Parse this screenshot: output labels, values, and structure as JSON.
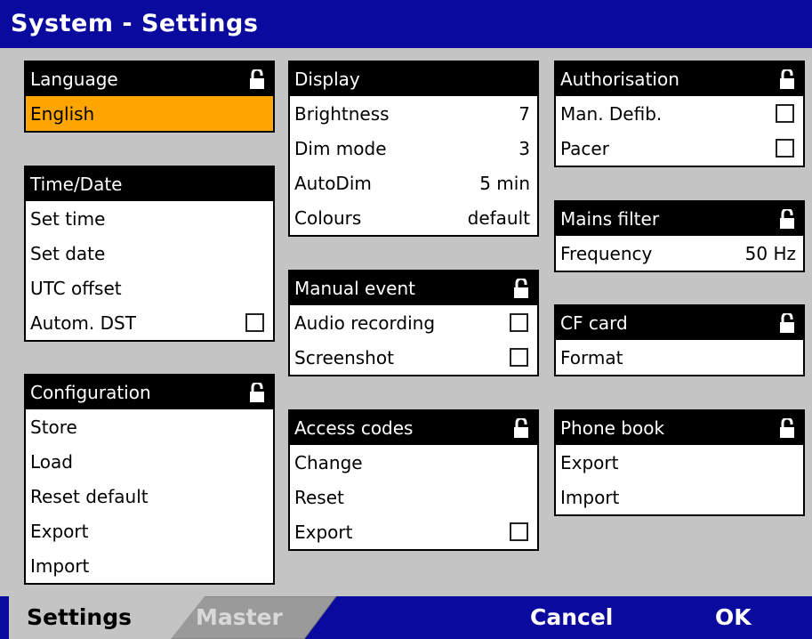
{
  "title": "System - Settings",
  "language": {
    "header": "Language",
    "value": "English"
  },
  "time_date": {
    "header": "Time/Date",
    "items": [
      "Set time",
      "Set date",
      "UTC offset",
      "Autom. DST"
    ]
  },
  "configuration": {
    "header": "Configuration",
    "items": [
      "Store",
      "Load",
      "Reset default",
      "Export",
      "Import"
    ]
  },
  "display": {
    "header": "Display",
    "rows": [
      {
        "label": "Brightness",
        "value": "7"
      },
      {
        "label": "Dim mode",
        "value": "3"
      },
      {
        "label": "AutoDim",
        "value": "5 min"
      },
      {
        "label": "Colours",
        "value": "default"
      }
    ]
  },
  "manual_event": {
    "header": "Manual event",
    "items": [
      "Audio recording",
      "Screenshot"
    ]
  },
  "access_codes": {
    "header": "Access codes",
    "items": [
      "Change",
      "Reset",
      "Export"
    ]
  },
  "authorisation": {
    "header": "Authorisation",
    "items": [
      "Man. Defib.",
      "Pacer"
    ]
  },
  "mains_filter": {
    "header": "Mains filter",
    "label": "Frequency",
    "value": "50 Hz"
  },
  "cf_card": {
    "header": "CF card",
    "items": [
      "Format"
    ]
  },
  "phone_book": {
    "header": "Phone book",
    "items": [
      "Export",
      "Import"
    ]
  },
  "tabs": {
    "settings": "Settings",
    "master": "Master"
  },
  "softkeys": {
    "cancel": "Cancel",
    "ok": "OK"
  },
  "colors": {
    "title_bar": "#0a0a9e",
    "selected": "#ffa500",
    "background": "#c4c4c4"
  },
  "icons": {
    "lock": "lock-icon",
    "checkbox": "checkbox"
  }
}
